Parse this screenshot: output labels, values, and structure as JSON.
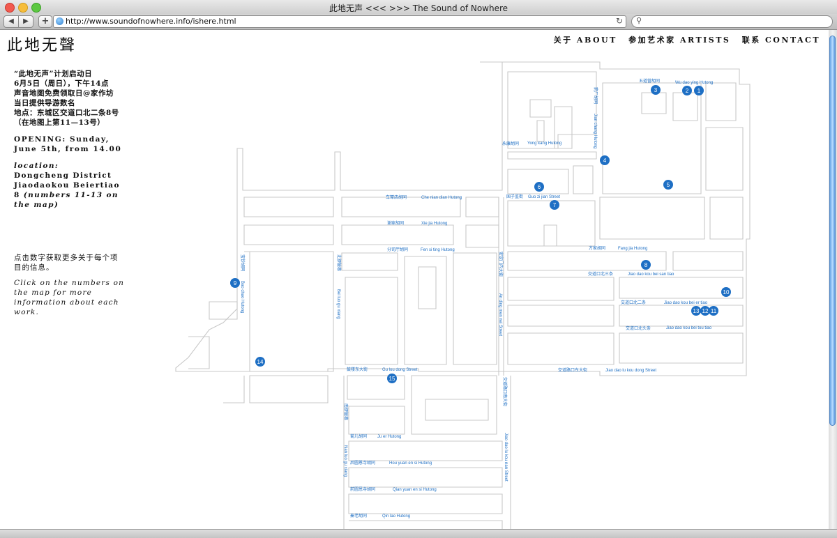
{
  "window": {
    "title": "此地无声 <<< >>> The Sound of Nowhere"
  },
  "toolbar": {
    "back": "◀",
    "forward": "▶",
    "add": "+",
    "url": "http://www.soundofnowhere.info/ishere.html",
    "reload": "↻",
    "search_icon": "⚲"
  },
  "site": {
    "logo": "此地无聲"
  },
  "nav": [
    {
      "label": "关于 ABOUT"
    },
    {
      "label": "参加艺术家 ARTISTS"
    },
    {
      "label": "联系 CONTACT"
    }
  ],
  "info": {
    "zh": [
      "“此地无声”计划启动日",
      "6月5日（周日），下午14点",
      "声音地图免费领取日@家作坊",
      "当日提供导游数名",
      "地点：东城区交道口北二条8号（在地图上第11—13号）"
    ],
    "opening": "OPENING: Sunday, June 5th, from 14.00",
    "location_label": "location:",
    "location": "Dongcheng District Jiaodaokou Beiertiao 8",
    "location_note": "(numbers 11-13 on the map)",
    "click_zh": "点击数字获取更多关于每个项目的信息。",
    "click_en": "Click on the numbers on the map for more information about each work."
  },
  "streets": [
    {
      "zh": "五道营胡同",
      "en": "Wu dao ying Hutong"
    },
    {
      "zh": "永康胡同",
      "en": "Yong kang Hutong"
    },
    {
      "zh": "车辇店胡同",
      "en": "Che nian dian Hutong"
    },
    {
      "zh": "国子监街",
      "en": "Guo zi jian Street"
    },
    {
      "zh": "谢家胡同",
      "en": "Xie jia Hutong"
    },
    {
      "zh": "分司厅胡同",
      "en": "Fen si ting Hutong"
    },
    {
      "zh": "方家胡同",
      "en": "Fang jia Hutong"
    },
    {
      "zh": "交道口北三条",
      "en": "Jiao dao kou bei san tiao"
    },
    {
      "zh": "交道口北二条",
      "en": "Jiao dao kou bei er tiao"
    },
    {
      "zh": "交道口北头条",
      "en": "Jiao dao kou bei tou tiao"
    },
    {
      "zh": "交道路口东大街",
      "en": "Jiao dao lu kou dong Street"
    },
    {
      "zh": "鼓楼东大街",
      "en": "Gu lou dong Street"
    },
    {
      "zh": "菊儿胡同",
      "en": "Ju er Hutong"
    },
    {
      "zh": "后圆恩寺胡同",
      "en": "Hou yuan en si Hutong"
    },
    {
      "zh": "前圆恩寺胡同",
      "en": "Qian yuan en si Hutong"
    },
    {
      "zh": "秦老胡同",
      "en": "Qin lao Hutong"
    },
    {
      "zh": "箭厂胡同",
      "en": "Jian chang Hutong"
    },
    {
      "zh": "安定门内大街",
      "en": "An ding men nei Street"
    },
    {
      "zh": "交道路口南大街",
      "en": "Jiao dao lu kou nan Street"
    },
    {
      "zh": "宝钞胡同",
      "en": "Bao chao Hutong"
    },
    {
      "zh": "北锣鼓巷",
      "en": "Bei luo gu xiang"
    },
    {
      "zh": "南锣鼓巷",
      "en": "Nan luo gu xiang"
    }
  ],
  "pins": [
    "1",
    "2",
    "3",
    "4",
    "5",
    "6",
    "7",
    "8",
    "9",
    "10",
    "11",
    "12",
    "13",
    "14",
    "15"
  ],
  "colors": {
    "accent": "#1e6fc4",
    "road": "#c8c8c8"
  }
}
